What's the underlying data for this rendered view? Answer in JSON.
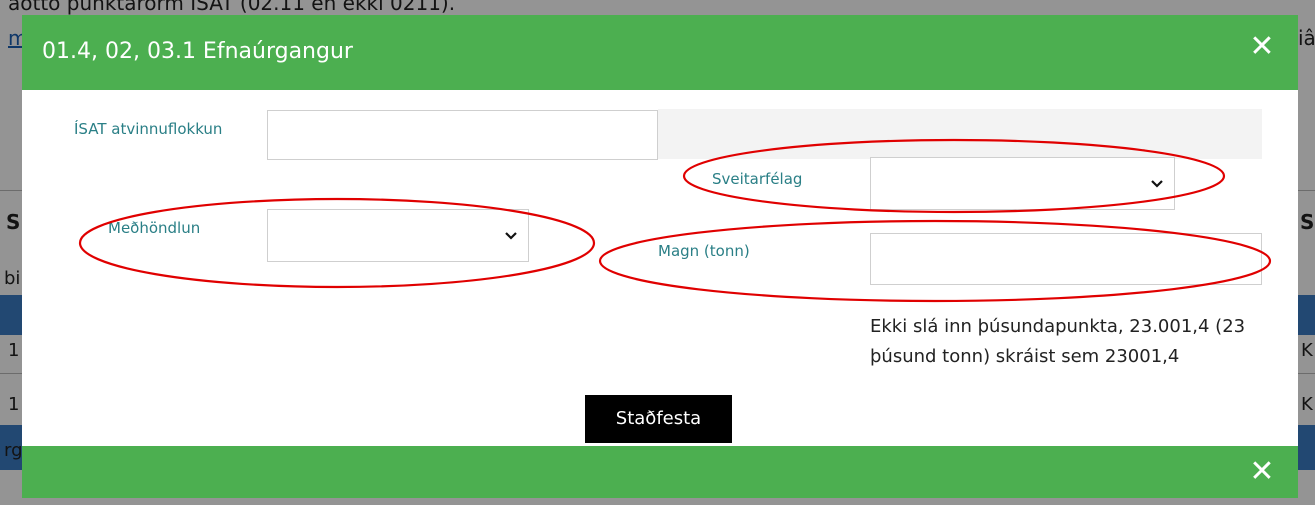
{
  "background": {
    "top_text": "aotto punktarorm ISAT (02.11 en ekki 0211).",
    "link_text": "m",
    "right_text": "iâ",
    "row_letters": [
      "S",
      "S"
    ],
    "cells": [
      "bi",
      "1",
      "1",
      "K",
      "K",
      "rg"
    ]
  },
  "modal": {
    "title": "01.4, 02, 03.1 Efnaúrgangur",
    "close_icon": "close-icon",
    "fields": {
      "isat_label": "ÍSAT atvinnuflokkun",
      "isat_value": "",
      "sveitarfelag_label": "Sveitarfélag",
      "sveitarfelag_value": "",
      "medhondlun_label": "Meðhöndlun",
      "medhondlun_value": "",
      "magn_label": "Magn (tonn)",
      "magn_value": ""
    },
    "hint_text": "Ekki slá inn þúsundapunkta, 23.001,4 (23 þúsund tonn) skráist sem 23001,4",
    "confirm_label": "Staðfesta"
  },
  "colors": {
    "header_green": "#4caf50",
    "label_teal": "#2a7f86",
    "annotation_red": "#e00000"
  }
}
